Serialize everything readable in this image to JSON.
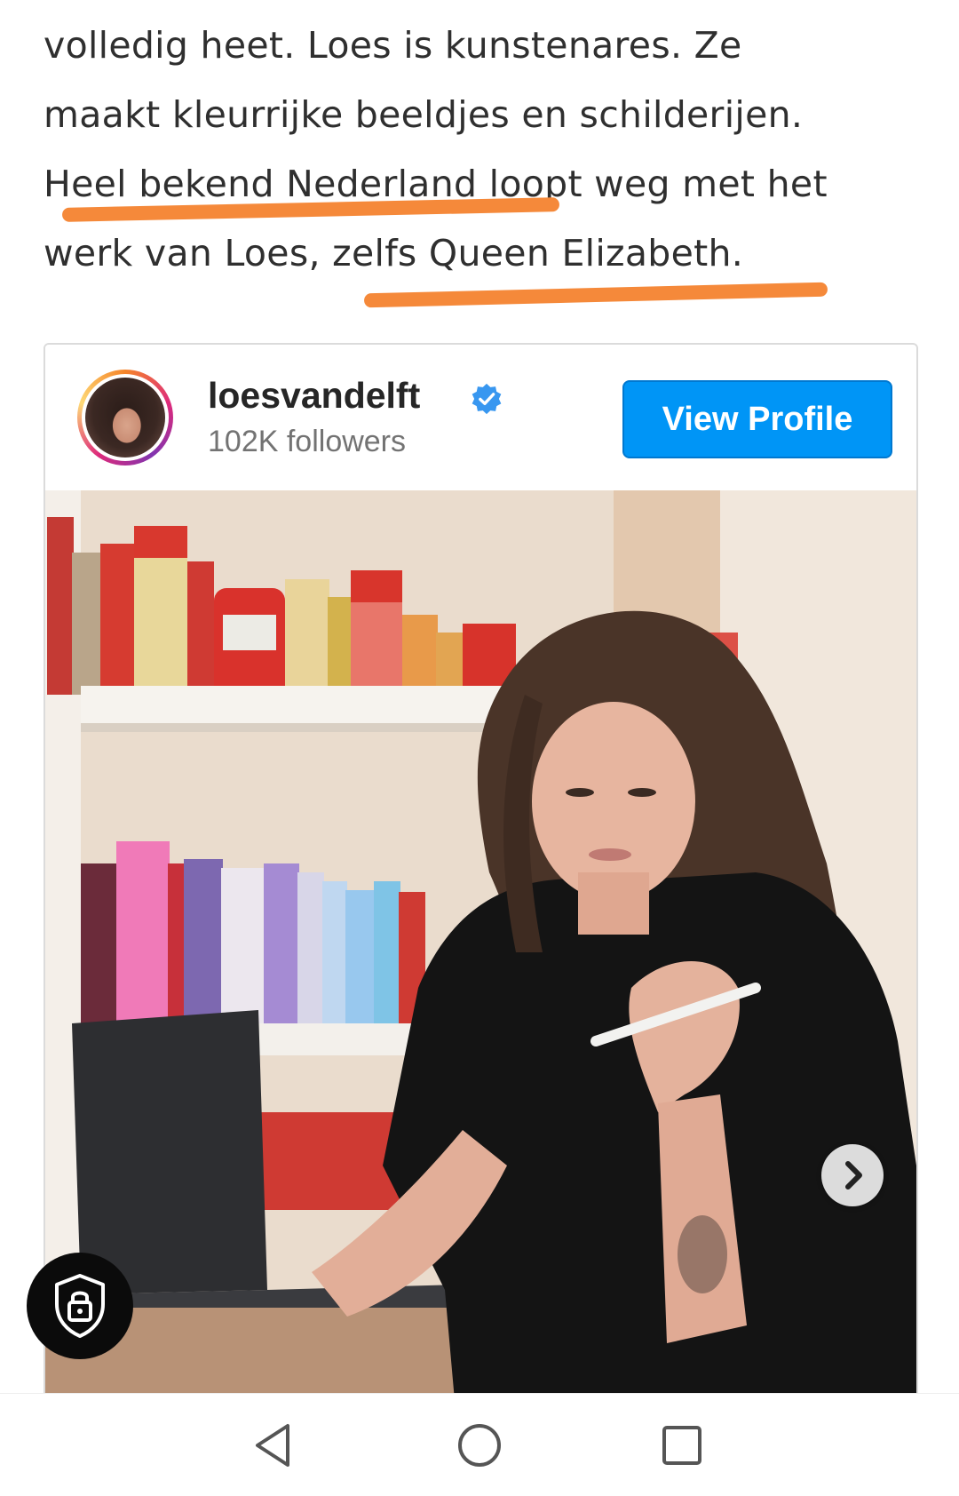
{
  "article": {
    "lines": [
      "volledig heet. Loes is kunstenares. Ze",
      "maakt kleurrijke beeldjes en schilderijen.",
      "Heel bekend Nederland loopt weg met het",
      "werk van Loes, zelfs Queen Elizabeth."
    ],
    "underline_color": "#f5893a"
  },
  "embed": {
    "username": "loesvandelft",
    "verified_icon": "verified-badge-icon",
    "followers": "102K followers",
    "view_profile_label": "View Profile",
    "button_color": "#0095f6",
    "photo": "photo of a woman with long brown hair in a black t-shirt holding a pen, looking at a laptop, in front of shelves full of acrylic paint tubes",
    "next_icon": "chevron-right-icon"
  },
  "privacy_button": {
    "icon": "shield-lock-icon"
  },
  "navbar": {
    "back_icon": "back-triangle-icon",
    "home_icon": "home-circle-icon",
    "recents_icon": "recents-square-icon"
  }
}
